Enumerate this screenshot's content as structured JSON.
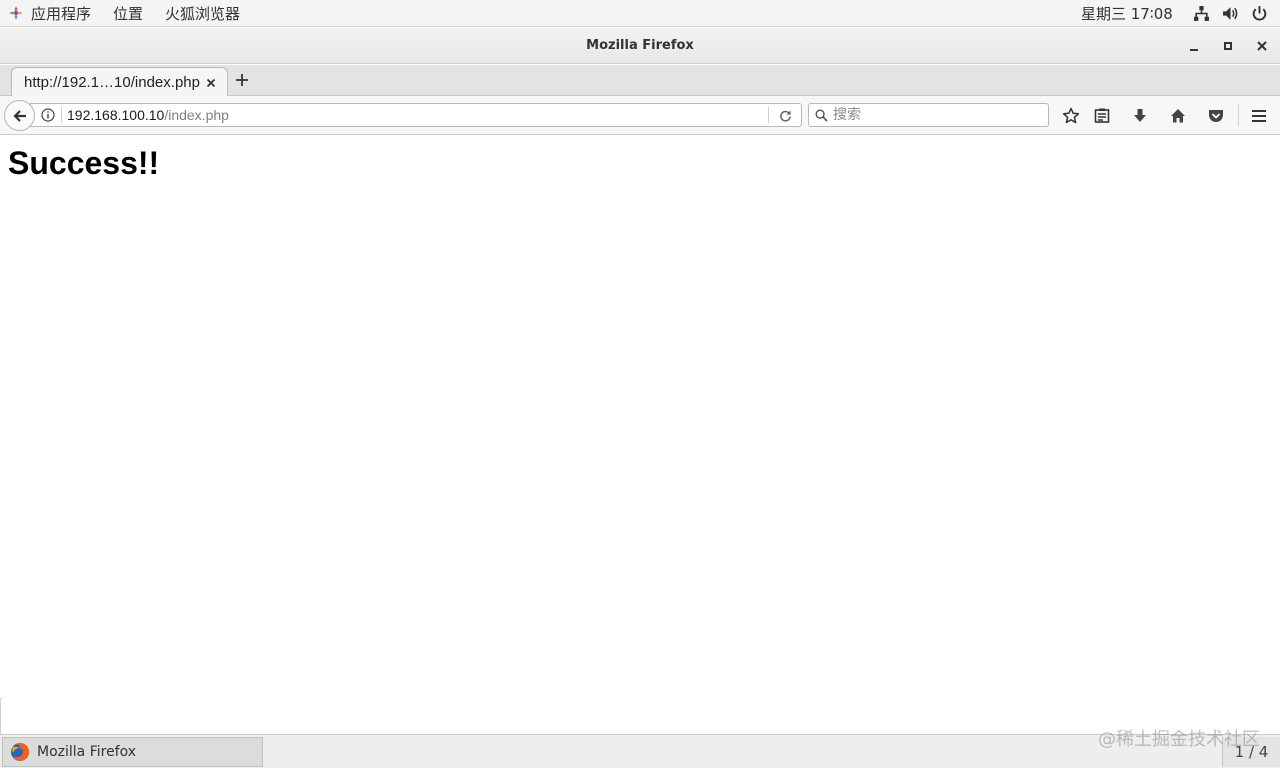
{
  "topbar": {
    "menus": [
      "应用程序",
      "位置",
      "火狐浏览器"
    ],
    "clock": "星期三 17∶08",
    "icons": [
      "network-icon",
      "volume-icon",
      "power-icon"
    ]
  },
  "window": {
    "title": "Mozilla Firefox"
  },
  "tabs": [
    {
      "title": "http://192.1…10/index.php",
      "active": true
    }
  ],
  "navbar": {
    "url_host": "192.168.100.10",
    "url_path": "/index.php",
    "search_placeholder": "搜索"
  },
  "page": {
    "heading": "Success!!"
  },
  "taskbar": {
    "item_label": "Mozilla Firefox",
    "workspace": "1 / 4"
  },
  "watermark": "@稀土掘金技术社区"
}
